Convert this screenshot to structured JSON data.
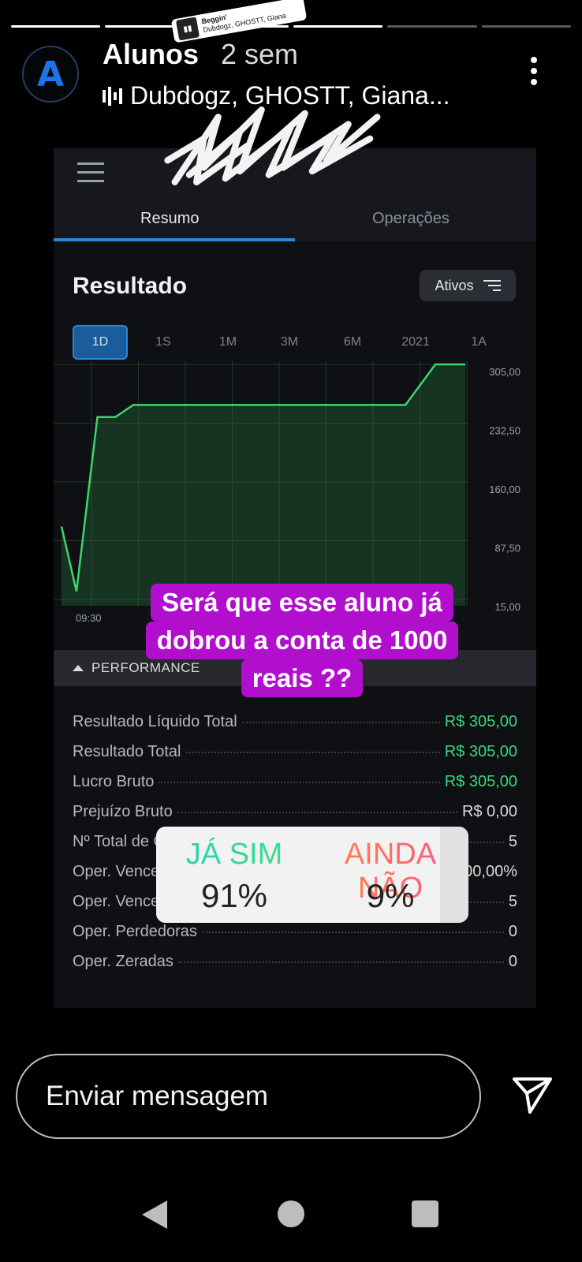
{
  "story": {
    "segments": 6,
    "segments_done": 4,
    "avatar_letter": "A",
    "username": "Alunos",
    "time": "2 sem",
    "music": "Dubdogz, GHOSTT, Giana..."
  },
  "sticker": {
    "song_title": "Beggin'",
    "artists": "Dubdogz, GHOSTT, Giana"
  },
  "app": {
    "tabs": [
      "Resumo",
      "Operações"
    ],
    "active_tab": 0,
    "result_title": "Resultado",
    "filter_label": "Ativos",
    "periods": [
      "1D",
      "1S",
      "1M",
      "3M",
      "6M",
      "2021",
      "1A"
    ],
    "active_period": 0,
    "performance_label": "PERFORMANCE"
  },
  "chart_data": {
    "type": "area",
    "x_tick_labels": [
      "09:30"
    ],
    "y_ticks": [
      "305,00",
      "232,50",
      "160,00",
      "87,50",
      "15,00"
    ],
    "ylim": [
      15,
      305
    ],
    "grid": true,
    "color": "#3fd46a",
    "points": [
      {
        "t": 0,
        "v": 105
      },
      {
        "t": 0.5,
        "v": 25
      },
      {
        "t": 1.2,
        "v": 240
      },
      {
        "t": 1.8,
        "v": 240
      },
      {
        "t": 2.4,
        "v": 255
      },
      {
        "t": 11.5,
        "v": 255
      },
      {
        "t": 12.5,
        "v": 305
      },
      {
        "t": 13.5,
        "v": 305
      }
    ]
  },
  "performance": {
    "rows": [
      {
        "label": "Resultado Líquido Total",
        "value": "R$ 305,00",
        "green": true
      },
      {
        "label": "Resultado Total",
        "value": "R$ 305,00",
        "green": true
      },
      {
        "label": "Lucro Bruto",
        "value": "R$ 305,00",
        "green": true
      },
      {
        "label": "Prejuízo Bruto",
        "value": "R$ 0,00",
        "green": false
      },
      {
        "label": "Nº Total de Operações",
        "value": "5",
        "green": false
      },
      {
        "label": "Oper. Vencedoras (%)",
        "value": "100,00%",
        "green": false
      },
      {
        "label": "Oper. Vencedoras",
        "value": "5",
        "green": false
      },
      {
        "label": "Oper. Perdedoras",
        "value": "0",
        "green": false
      },
      {
        "label": "Oper. Zeradas",
        "value": "0",
        "green": false
      }
    ]
  },
  "question": {
    "lines": [
      "Será que esse aluno já",
      "dobrou a conta de 1000",
      "reais ??"
    ],
    "color": "#b10fcd"
  },
  "poll": {
    "option_a": "JÁ SIM",
    "option_b": "AINDA NÃO",
    "pct_a": "91%",
    "pct_b": "9%",
    "fraction_a": 0.91
  },
  "reply": {
    "placeholder": "Enviar mensagem"
  }
}
